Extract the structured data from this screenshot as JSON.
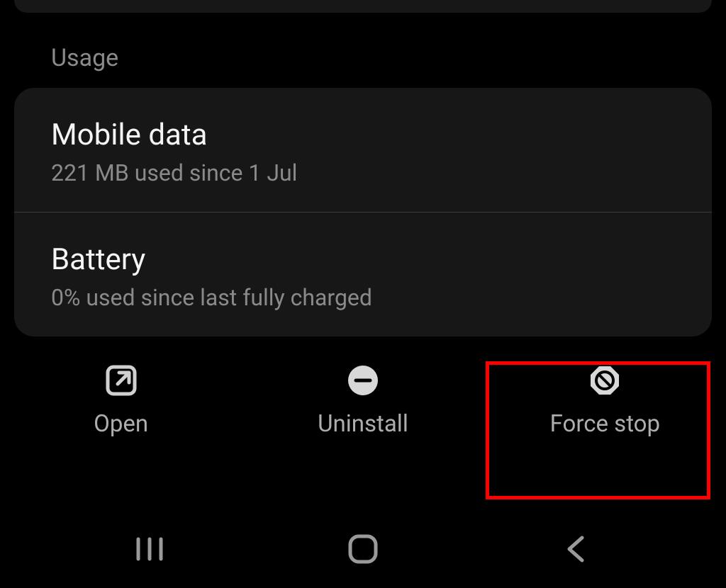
{
  "section": {
    "header": "Usage",
    "items": [
      {
        "title": "Mobile data",
        "subtitle": "221 MB used since 1 Jul"
      },
      {
        "title": "Battery",
        "subtitle": "0% used since last fully charged"
      }
    ]
  },
  "actions": {
    "open": "Open",
    "uninstall": "Uninstall",
    "force_stop": "Force stop"
  }
}
